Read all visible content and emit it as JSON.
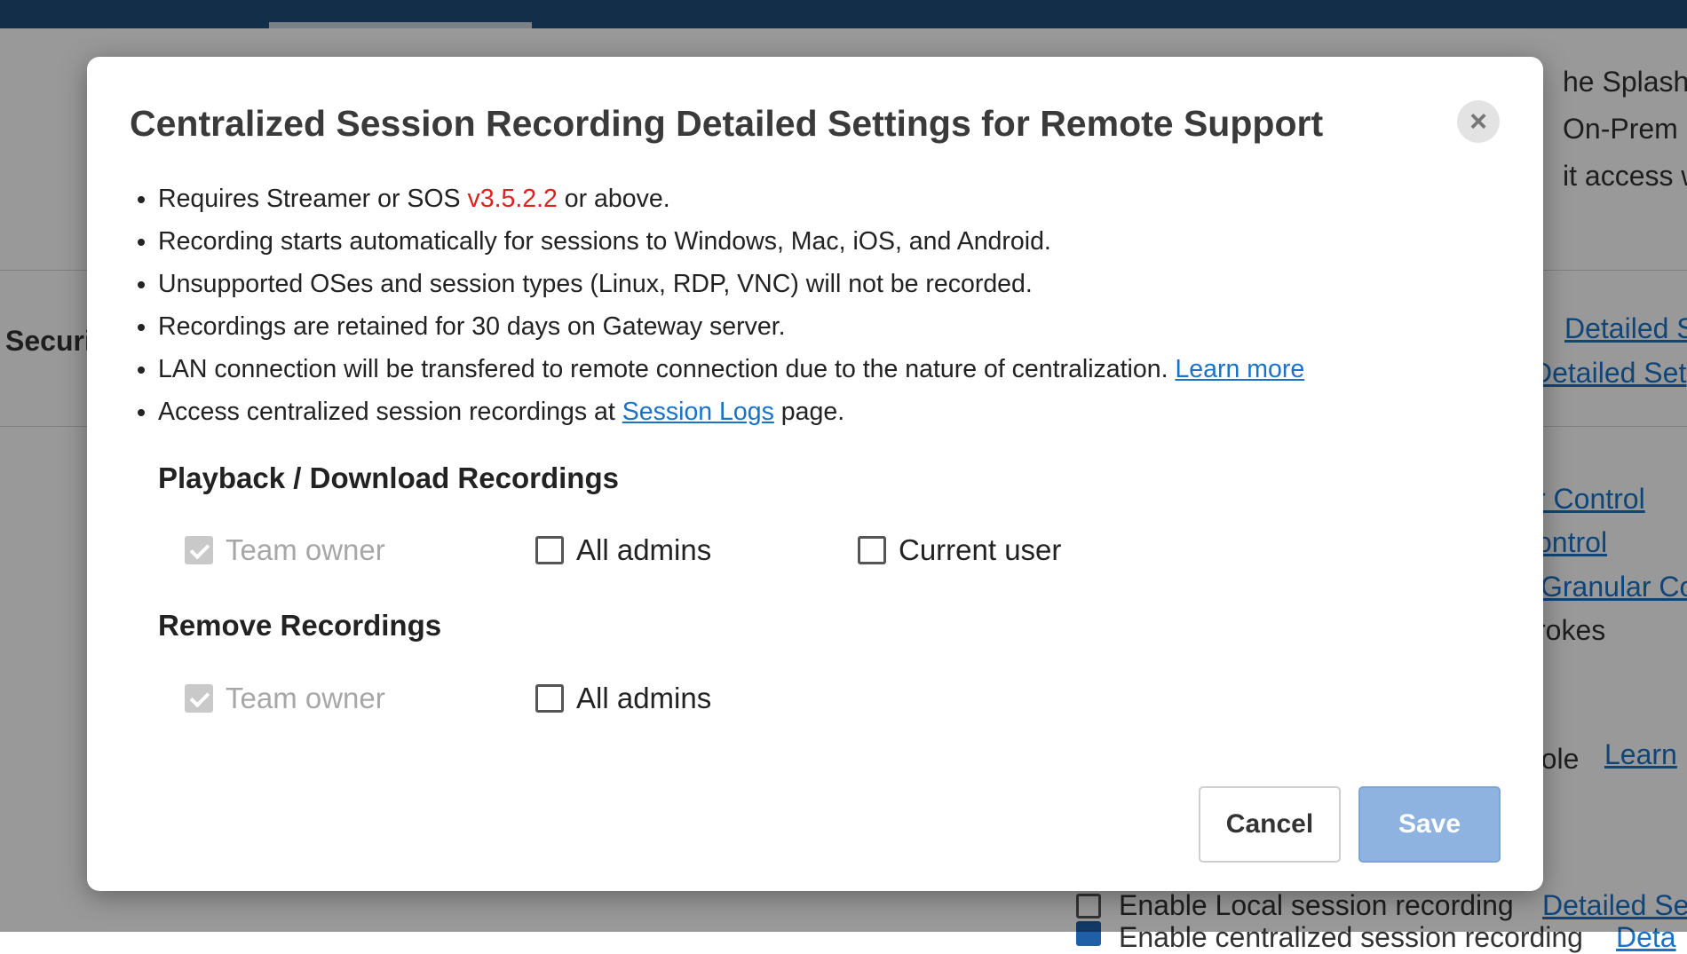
{
  "background": {
    "right_lines": [
      "he Splashto",
      "On-Prem Cl",
      "it access wi"
    ],
    "left_label": "Securi",
    "right_links": [
      "Detailed S",
      "Detailed Set"
    ],
    "control_links": [
      "r Control",
      "ontrol",
      "Granular Co"
    ],
    "strokes_text": "rokes",
    "role_text": "role",
    "role_link": "Learn",
    "local_recording_label": "Enable Local session recording",
    "local_recording_link": "Detailed Se",
    "centralized_label": "Enable centralized session recording",
    "centralized_link": "Deta"
  },
  "modal": {
    "title": "Centralized Session Recording Detailed Settings for Remote Support",
    "close_symbol": "×",
    "requirements": {
      "item1_prefix": "Requires Streamer or SOS ",
      "item1_version": "v3.5.2.2",
      "item1_suffix": " or above.",
      "item2": "Recording starts automatically for sessions to Windows, Mac, iOS, and Android.",
      "item3": "Unsupported OSes and session types (Linux, RDP, VNC) will not be recorded.",
      "item4": "Recordings are retained for 30 days on Gateway server.",
      "item5_text": "LAN connection will be transfered to remote connection due to the nature of centralization. ",
      "item5_link": "Learn more",
      "item6_prefix": "Access centralized session recordings at ",
      "item6_link": "Session Logs",
      "item6_suffix": " page."
    },
    "playback": {
      "title": "Playback / Download Recordings",
      "options": [
        {
          "label": "Team owner",
          "checked": true,
          "disabled": true
        },
        {
          "label": "All admins",
          "checked": false,
          "disabled": false
        },
        {
          "label": "Current user",
          "checked": false,
          "disabled": false
        }
      ]
    },
    "remove": {
      "title": "Remove Recordings",
      "options": [
        {
          "label": "Team owner",
          "checked": true,
          "disabled": true
        },
        {
          "label": "All admins",
          "checked": false,
          "disabled": false
        }
      ]
    },
    "buttons": {
      "cancel": "Cancel",
      "save": "Save"
    }
  },
  "colors": {
    "topbar": "#1f4e79",
    "link": "#1a73c9",
    "version": "#e02020",
    "save_button": "#8fb3e0"
  }
}
